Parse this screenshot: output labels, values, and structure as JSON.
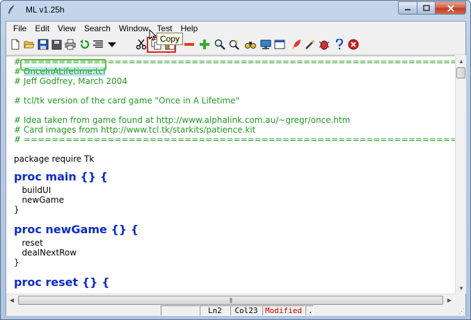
{
  "window": {
    "title": "ML v1.25h"
  },
  "menu": [
    "File",
    "Edit",
    "View",
    "Search",
    "Window",
    "Test",
    "Help"
  ],
  "toolbar": {
    "tooltip": "Copy"
  },
  "editor": {
    "comment_rule": "# =========================================================================================================",
    "lines": {
      "l1_hash": "# ",
      "l1_filename": "OnceInALifetime.tcl",
      "l2": "# Jeff Godfrey, March 2004",
      "l3": "# tcl/tk version of the card game \"Once in A Lifetime\"",
      "l4": "# Idea taken from game found at http://www.alphalink.com.au/~gregr/once.htm",
      "l5": "# Card images from http://www.tcl.tk/starkits/patience.kit",
      "l6": "package require Tk",
      "p1": "proc main {} {",
      "p1a": "   buildUI",
      "p1b": "   newGame",
      "p1c": "}",
      "p2": "proc newGame {} {",
      "p2a": "   reset",
      "p2b": "   dealNextRow",
      "p2c": "}",
      "p3": "proc reset {} {"
    }
  },
  "status": {
    "line": "Ln2",
    "col": "Col23",
    "modified": "Modified",
    "extra": "."
  },
  "colors": {
    "comment": "#1f9a1f",
    "keyword": "#0a2ad4",
    "modified": "#d40000"
  }
}
